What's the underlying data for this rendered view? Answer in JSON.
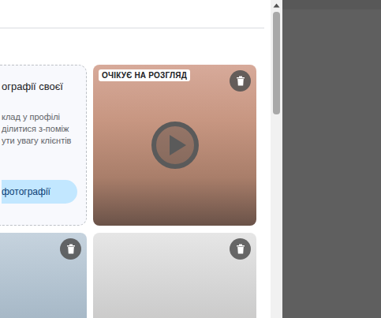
{
  "upload_card": {
    "title": "ографії своєї",
    "lines": [
      "клад у профілі",
      "ділитися з-поміж",
      "ути увагу клієнтів"
    ],
    "button": "фотографії"
  },
  "media": [
    {
      "kind": "video",
      "badge": "ОЧІКУЄ НА РОЗГЛЯД",
      "deletable": true
    },
    {
      "kind": "photo",
      "deletable": true
    },
    {
      "kind": "photo",
      "deletable": true
    }
  ]
}
